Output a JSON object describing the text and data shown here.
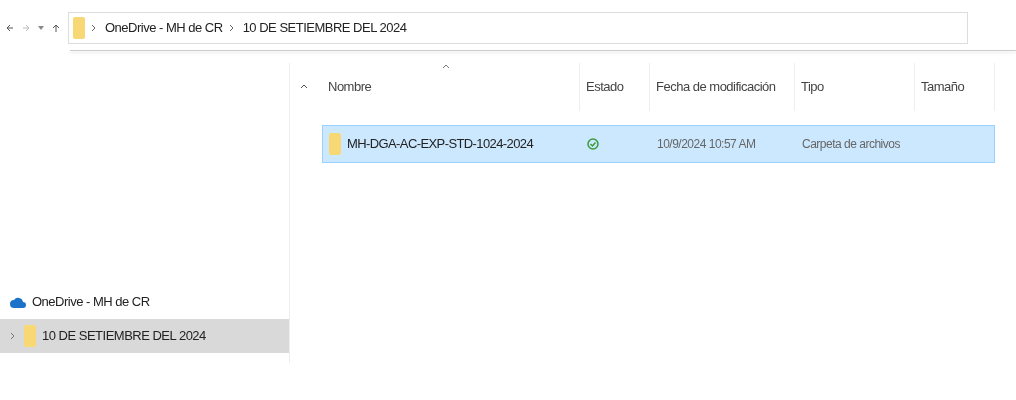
{
  "address_bar": {
    "crumbs": [
      "OneDrive - MH de CR",
      "10 DE SETIEMBRE DEL 2024"
    ]
  },
  "table": {
    "columns": [
      "Nombre",
      "Estado",
      "Fecha de modificación",
      "Tipo",
      "Tamaño"
    ],
    "rows": [
      {
        "name": "MH-DGA-AC-EXP-STD-1024-2024",
        "synced": true,
        "modified": "10/9/2024 10:57 AM",
        "type": "Carpeta de archivos",
        "selected": true
      }
    ]
  },
  "sidebar": {
    "items": [
      {
        "kind": "cloud",
        "label": "OneDrive - MH de CR",
        "selected": false
      },
      {
        "kind": "folder",
        "label": "10 DE SETIEMBRE DEL 2024",
        "selected": true
      }
    ]
  }
}
